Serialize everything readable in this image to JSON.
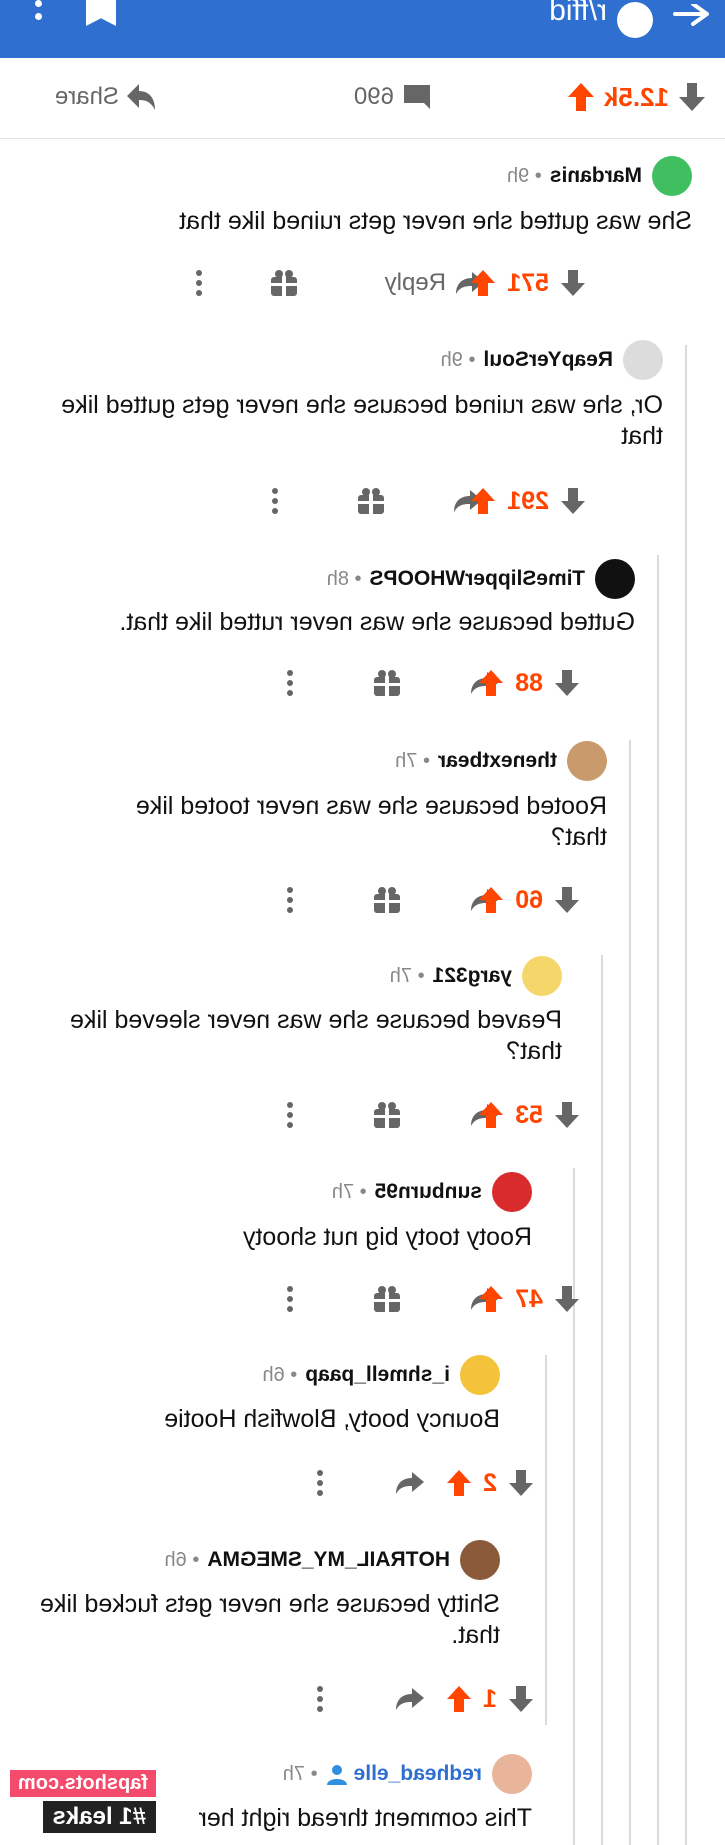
{
  "appbar": {
    "subreddit": "r/ffid",
    "icons": [
      "back-arrow-icon",
      "bookmark-icon",
      "more-vertical-icon"
    ]
  },
  "post": {
    "score": "12.5k",
    "comments": "690",
    "share_label": "Share"
  },
  "colors": {
    "accent": "#2f6fd0",
    "upvote": "#ff4500",
    "muted": "#666666"
  },
  "comments": [
    {
      "user": "Mardanis",
      "time": "9h",
      "text": "She was gutted she never gets ruined like that",
      "score": "571",
      "reply_label": "Reply"
    },
    {
      "user": "ReapYerSoul",
      "time": "9h",
      "text": "Or, she was ruined because she never gets gutted like that",
      "score": "291"
    },
    {
      "user": "TimeSlipperWHOOPS",
      "time": "8h",
      "text": "Gutted because she was never rutted like that.",
      "score": "88"
    },
    {
      "user": "thenextbear",
      "time": "7h",
      "text": "Rooted because she was never tooted like that?",
      "score": "60"
    },
    {
      "user": "yarg321",
      "time": "7h",
      "text": "Peaved because she was never sleeved like that?",
      "score": "53"
    },
    {
      "user": "sunburn95",
      "time": "7h",
      "text": "Rooty tooty big nut shooty",
      "score": "47"
    },
    {
      "user": "i_shmell_paap",
      "time": "6h",
      "text": "Bouncy booty, Blowfish Hootie",
      "score": "2"
    },
    {
      "user": "HOTRAIL_MY_SMEGMA",
      "time": "6h",
      "text": "Shitty because she never gets fucked like that.",
      "score": "1"
    },
    {
      "user": "redhead_elle",
      "time": "7h",
      "text": "This comment thread right her"
    }
  ],
  "watermark": {
    "line1": "fapshots.com",
    "line2": "#1 leaks"
  }
}
